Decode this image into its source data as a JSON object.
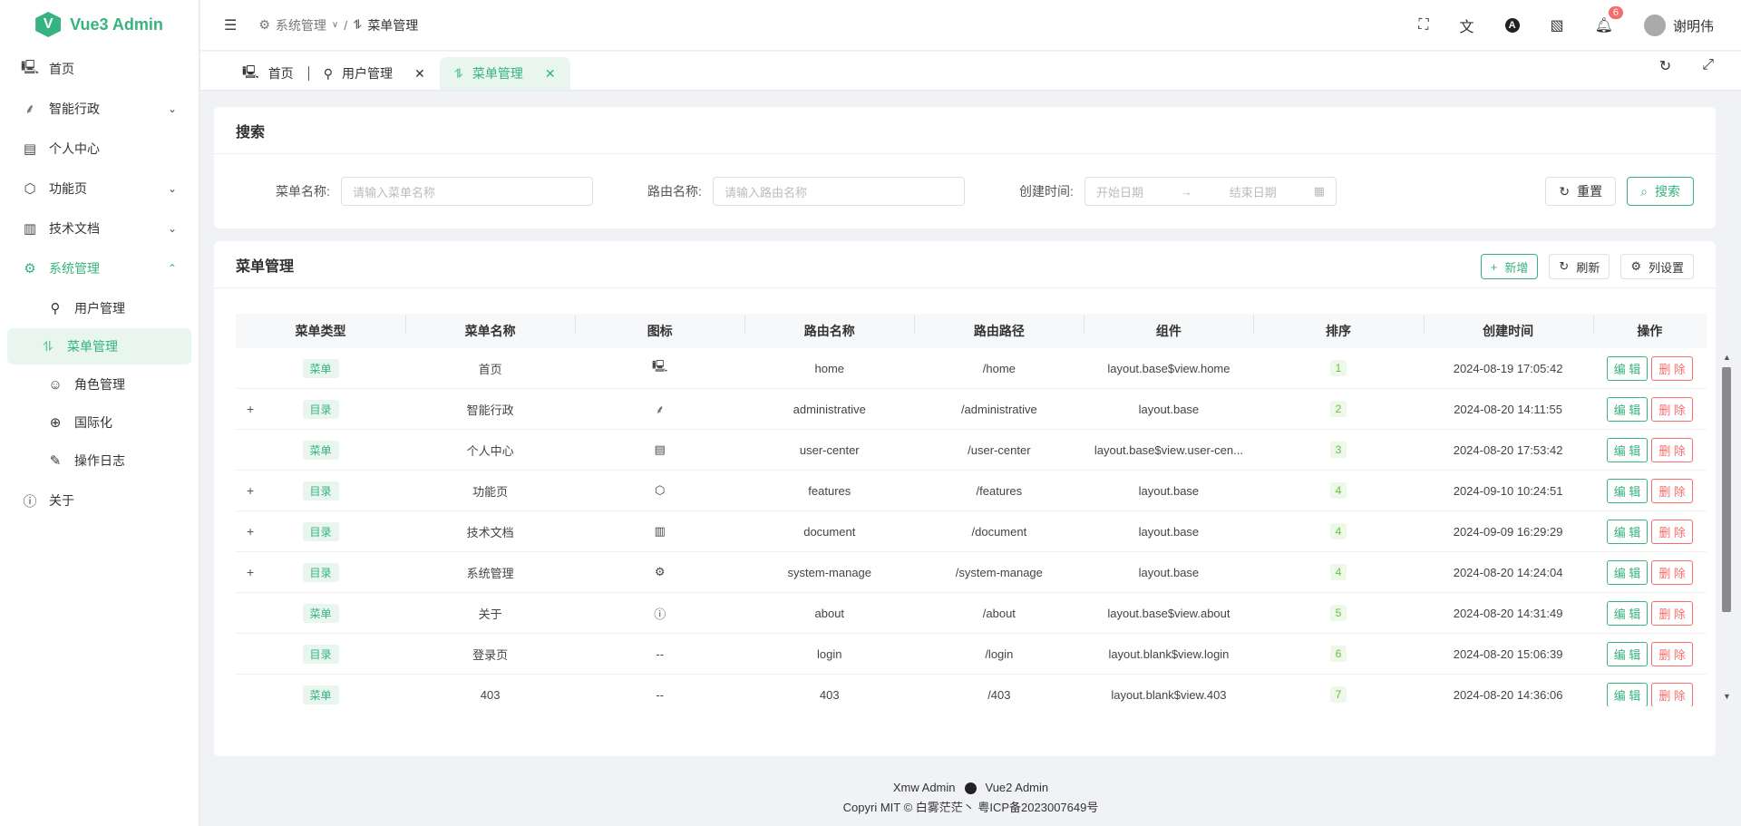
{
  "app": {
    "name": "Vue3 Admin",
    "logo_letter": "V",
    "accent_color": "#36b37e"
  },
  "sidebar": {
    "items": [
      {
        "label": "首页",
        "icon": "monitor-icon"
      },
      {
        "label": "智能行政",
        "icon": "leaf-icon",
        "expandable": true
      },
      {
        "label": "个人中心",
        "icon": "id-card-icon"
      },
      {
        "label": "功能页",
        "icon": "cube-icon",
        "expandable": true
      },
      {
        "label": "技术文档",
        "icon": "document-icon",
        "expandable": true
      },
      {
        "label": "系统管理",
        "icon": "gear-icon",
        "expandable": true,
        "expanded": true
      }
    ],
    "sub_items": [
      {
        "label": "用户管理",
        "icon": "user-key-icon"
      },
      {
        "label": "菜单管理",
        "icon": "route-icon",
        "active": true
      },
      {
        "label": "角色管理",
        "icon": "user-role-icon"
      },
      {
        "label": "国际化",
        "icon": "globe-icon"
      },
      {
        "label": "操作日志",
        "icon": "edit-log-icon"
      }
    ],
    "about": {
      "label": "关于",
      "icon": "info-icon"
    }
  },
  "header": {
    "breadcrumb": {
      "parent": "系统管理",
      "current": "菜单管理"
    },
    "notification_count": "6",
    "username": "谢明伟"
  },
  "tabs": [
    {
      "label": "首页",
      "closable": false
    },
    {
      "label": "用户管理",
      "closable": true
    },
    {
      "label": "菜单管理",
      "closable": true,
      "active": true
    }
  ],
  "search": {
    "title": "搜索",
    "menu_name_label": "菜单名称:",
    "menu_name_placeholder": "请输入菜单名称",
    "route_name_label": "路由名称:",
    "route_name_placeholder": "请输入路由名称",
    "created_label": "创建时间:",
    "start_placeholder": "开始日期",
    "end_placeholder": "结束日期",
    "range_separator": "→",
    "reset_label": "重置",
    "search_label": "搜索"
  },
  "table": {
    "title": "菜单管理",
    "add_label": "新增",
    "refresh_label": "刷新",
    "columns_label": "列设置",
    "headers": [
      "菜单类型",
      "菜单名称",
      "图标",
      "路由名称",
      "路由路径",
      "组件",
      "排序",
      "创建时间",
      "操作"
    ],
    "edit_label": "编 辑",
    "delete_label": "删 除",
    "rows": [
      {
        "expand": "",
        "type": "菜单",
        "name": "首页",
        "icon": "monitor-icon",
        "icon_text": "",
        "route_name": "home",
        "path": "/home",
        "component": "layout.base$view.home",
        "sort": "1",
        "created": "2024-08-19 17:05:42"
      },
      {
        "expand": "+",
        "type": "目录",
        "name": "智能行政",
        "icon": "leaf-icon",
        "icon_text": "",
        "route_name": "administrative",
        "path": "/administrative",
        "component": "layout.base",
        "sort": "2",
        "created": "2024-08-20 14:11:55"
      },
      {
        "expand": "",
        "type": "菜单",
        "name": "个人中心",
        "icon": "id-card-icon",
        "icon_text": "",
        "route_name": "user-center",
        "path": "/user-center",
        "component": "layout.base$view.user-cen...",
        "sort": "3",
        "created": "2024-08-20 17:53:42"
      },
      {
        "expand": "+",
        "type": "目录",
        "name": "功能页",
        "icon": "cube-icon",
        "icon_text": "",
        "route_name": "features",
        "path": "/features",
        "component": "layout.base",
        "sort": "4",
        "created": "2024-09-10 10:24:51"
      },
      {
        "expand": "+",
        "type": "目录",
        "name": "技术文档",
        "icon": "document-icon",
        "icon_text": "",
        "route_name": "document",
        "path": "/document",
        "component": "layout.base",
        "sort": "4",
        "created": "2024-09-09 16:29:29"
      },
      {
        "expand": "+",
        "type": "目录",
        "name": "系统管理",
        "icon": "gear-icon",
        "icon_text": "",
        "route_name": "system-manage",
        "path": "/system-manage",
        "component": "layout.base",
        "sort": "4",
        "created": "2024-08-20 14:24:04"
      },
      {
        "expand": "",
        "type": "菜单",
        "name": "关于",
        "icon": "info-icon",
        "icon_text": "",
        "route_name": "about",
        "path": "/about",
        "component": "layout.base$view.about",
        "sort": "5",
        "created": "2024-08-20 14:31:49"
      },
      {
        "expand": "",
        "type": "目录",
        "name": "登录页",
        "icon": "",
        "icon_text": "--",
        "route_name": "login",
        "path": "/login",
        "component": "layout.blank$view.login",
        "sort": "6",
        "created": "2024-08-20 15:06:39"
      },
      {
        "expand": "",
        "type": "菜单",
        "name": "403",
        "icon": "",
        "icon_text": "--",
        "route_name": "403",
        "path": "/403",
        "component": "layout.blank$view.403",
        "sort": "7",
        "created": "2024-08-20 14:36:06"
      }
    ]
  },
  "footer": {
    "line1_a": "Xmw Admin",
    "line1_b": "Vue2 Admin",
    "line2": "Copyri  MIT © 白雾茫茫丶 粤ICP备2023007649号"
  }
}
